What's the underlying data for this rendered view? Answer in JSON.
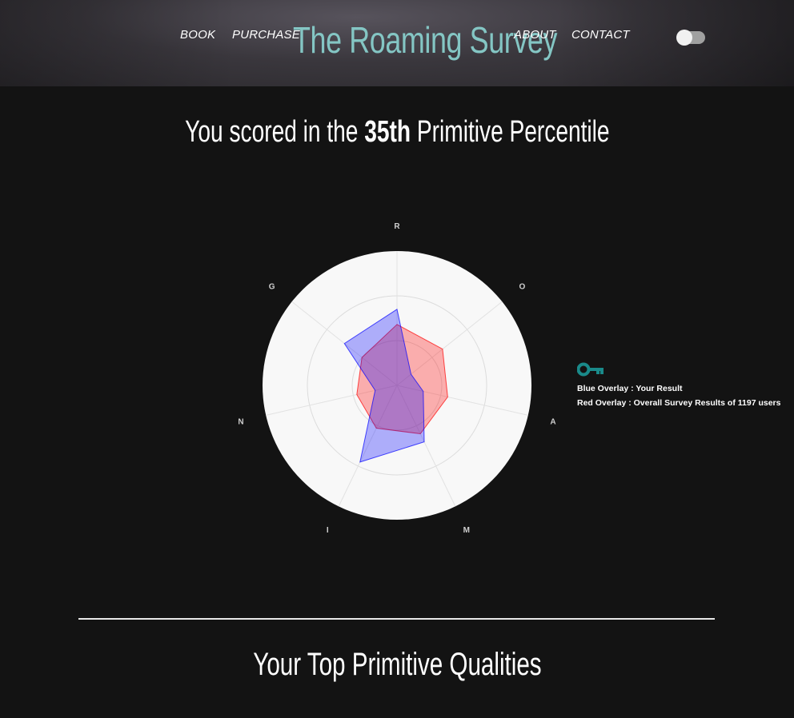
{
  "nav": {
    "book": "BOOK",
    "purchase": "PURCHASE",
    "brand": "The Roaming Survey",
    "about": "ABOUT",
    "contact": "CONTACT"
  },
  "theme_toggle": {
    "state": "off"
  },
  "score": {
    "prefix": "You scored in the",
    "value": "35th",
    "suffix": "Primitive Percentile"
  },
  "chart_data": {
    "type": "radar",
    "axes": [
      "R",
      "O",
      "A",
      "M",
      "I",
      "N",
      "G"
    ],
    "range": [
      0,
      100
    ],
    "grid": true,
    "series": [
      {
        "name": "Your Result",
        "color": "#0000ff",
        "values": [
          85,
          20,
          30,
          70,
          95,
          25,
          75
        ]
      },
      {
        "name": "Overall Survey Results of 1197 users",
        "color": "#ff0000",
        "values": [
          68,
          65,
          58,
          60,
          53,
          46,
          50
        ]
      }
    ]
  },
  "legend": {
    "icon": "key-icon",
    "icon_color": "#1a8a8a",
    "blue_line": "Blue Overlay : Your Result",
    "red_line": "Red Overlay : Overall Survey Results of 1197 users"
  },
  "section": {
    "title": "Your Top Primitive Qualities"
  }
}
